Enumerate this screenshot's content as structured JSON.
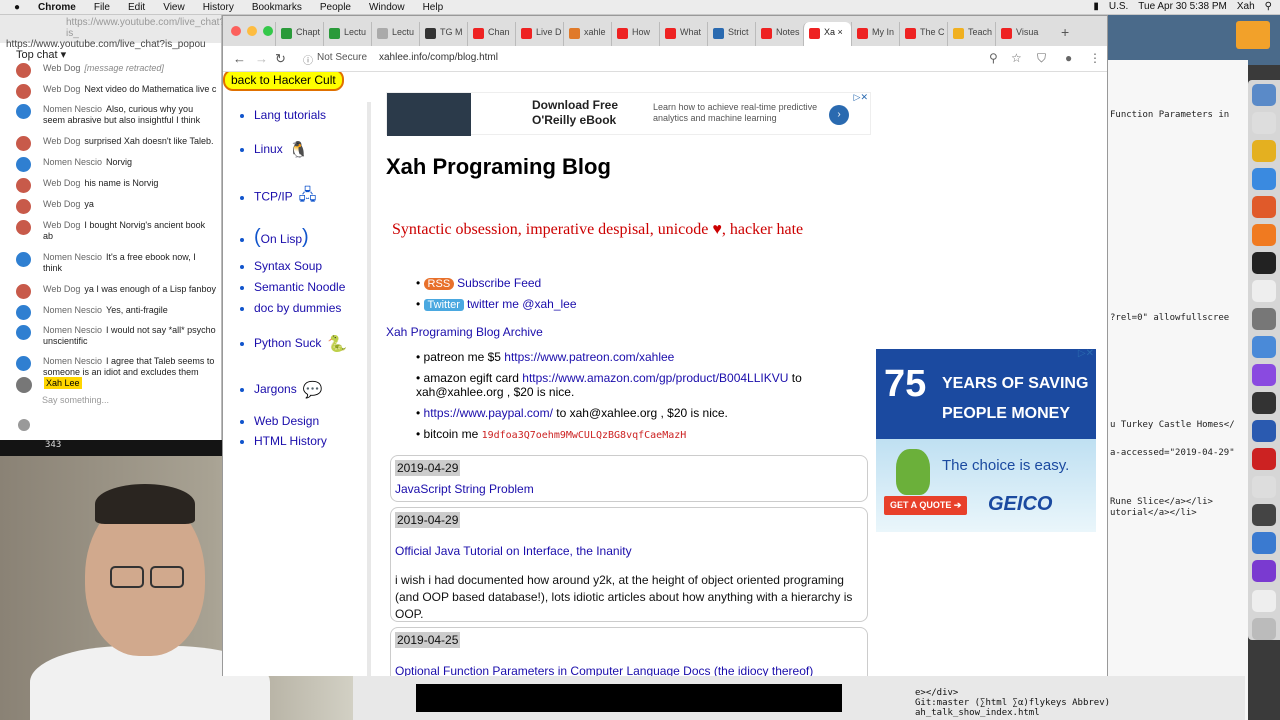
{
  "menubar": {
    "app": "Chrome",
    "items": [
      "File",
      "Edit",
      "View",
      "History",
      "Bookmarks",
      "People",
      "Window",
      "Help"
    ],
    "lang": "U.S.",
    "clock": "Tue Apr 30  5:38 PM",
    "user": "Xah"
  },
  "chat": {
    "url_faded": "https://www.youtube.com/live_chat?is_",
    "url": "https://www.youtube.com/live_chat?is_popou",
    "header": "Top chat",
    "messages": [
      {
        "who": "Web Dog",
        "text": "[message retracted]",
        "type": "dog",
        "retracted": true
      },
      {
        "who": "Web Dog",
        "text": "Next video do Mathematica live c",
        "type": "dog"
      },
      {
        "who": "Nomen Nescio",
        "text": "Also, curious why you seem abrasive but also insightful I think",
        "type": "nom"
      },
      {
        "who": "Web Dog",
        "text": "surprised Xah doesn't like Taleb.",
        "type": "dog"
      },
      {
        "who": "Nomen Nescio",
        "text": "Norvig",
        "type": "nom"
      },
      {
        "who": "Web Dog",
        "text": "his name is Norvig",
        "type": "dog"
      },
      {
        "who": "Web Dog",
        "text": "ya",
        "type": "dog"
      },
      {
        "who": "Web Dog",
        "text": "I bought Norvig's ancient book ab",
        "type": "dog"
      },
      {
        "who": "Nomen Nescio",
        "text": "It's a free ebook now, I think",
        "type": "nom"
      },
      {
        "who": "Web Dog",
        "text": "ya I was enough of a Lisp fanboy",
        "type": "dog"
      },
      {
        "who": "Nomen Nescio",
        "text": "Yes, anti-fragile",
        "type": "nom"
      },
      {
        "who": "Nomen Nescio",
        "text": "I would not say *all* psycho unscientific",
        "type": "nom"
      },
      {
        "who": "Nomen Nescio",
        "text": "I agree that Taleb seems to someone is an idiot and excludes them",
        "type": "nom"
      }
    ],
    "me": "Xah Lee",
    "say": "Say something..."
  },
  "terminal": {
    "text": "343"
  },
  "browser": {
    "tabs": [
      "Chapt",
      "Lectu",
      "Lectu",
      "TG M",
      "Chan",
      "Live D",
      "xahle",
      "How",
      "What",
      "Strict",
      "Notes",
      "Xa",
      "My In",
      "The C",
      "Teach",
      "Visua"
    ],
    "not_secure": "Not Secure",
    "url": "xahlee.info/comp/blog.html"
  },
  "page": {
    "back": "back to Hacker Cult",
    "nav": [
      {
        "label": "Lang tutorials",
        "icon": ""
      },
      {
        "label": "Linux",
        "icon": "🐧"
      },
      {
        "label": "TCP/IP",
        "icon": "🖧"
      },
      {
        "label": "On Lisp",
        "icon": ""
      },
      {
        "label": "Syntax Soup",
        "icon": ""
      },
      {
        "label": "Semantic Noodle",
        "icon": ""
      },
      {
        "label": "doc by dummies",
        "icon": ""
      },
      {
        "label": "Python Suck",
        "icon": "🐍"
      },
      {
        "label": "Jargons",
        "icon": "💬"
      },
      {
        "label": "Web Design",
        "icon": ""
      },
      {
        "label": "HTML History",
        "icon": ""
      }
    ],
    "ad1": {
      "title": "Download Free O'Reilly eBook",
      "text": "Learn how to achieve real-time predictive analytics and machine learning"
    },
    "title": "Xah Programing Blog",
    "tagline": "Syntactic obsession, imperative despisal, unicode ♥, hacker hate",
    "rss_badge": "RSS",
    "rss": "Subscribe Feed",
    "tw_badge": "Twitter",
    "tw": "twitter me @xah_lee",
    "archive": "Xah Programing Blog Archive",
    "donate": {
      "patreon_pre": "patreon me $5 ",
      "patreon_link": "https://www.patreon.com/xahlee",
      "amazon_pre": "amazon egift card ",
      "amazon_link": "https://www.amazon.com/gp/product/B004LLIKVU",
      "amazon_post": " to xah@xahlee.org , $20 is nice.",
      "paypal_link": "https://www.paypal.com/",
      "paypal_post": " to xah@xahlee.org , $20 is nice.",
      "btc_pre": "bitcoin me ",
      "btc": "19dfoa3Q7oehm9MwCULQzBG8vqfCaeMazH"
    },
    "posts": [
      {
        "date": "2019-04-29",
        "title": "JavaScript String Problem",
        "body": ""
      },
      {
        "date": "2019-04-29",
        "title": "Official Java Tutorial on Interface, the Inanity",
        "body": "i wish i had documented how around y2k, at the height of object oriented programing (and OOP based database!), lots idiotic articles about how anything with a hierarchy is OOP."
      },
      {
        "date": "2019-04-25",
        "title": "Optional Function Parameters in Computer Language Docs (the idiocy thereof)",
        "body": ""
      }
    ],
    "ad2": {
      "big": "75",
      "text": "YEARS OF SAVING PEOPLE MONEY",
      "choice": "The choice is easy.",
      "quote": "GET A QUOTE ➔",
      "brand": "GEICO"
    }
  },
  "editor": {
    "lines": [
      "Function Parameters in",
      "?rel=0\" allowfullscree",
      "u Turkey Castle Homes</",
      "a-accessed=\"2019-04-29\"",
      "Rune Slice</a></li>",
      "utorial</a></li>"
    ],
    "bottom1": "e></div>",
    "modeline": "  Git:master  (∑html ∑α)flykeys Abbrev)",
    "file": "ah_talk_show_index.html"
  },
  "desktop": {
    "label": "osh Serv"
  }
}
